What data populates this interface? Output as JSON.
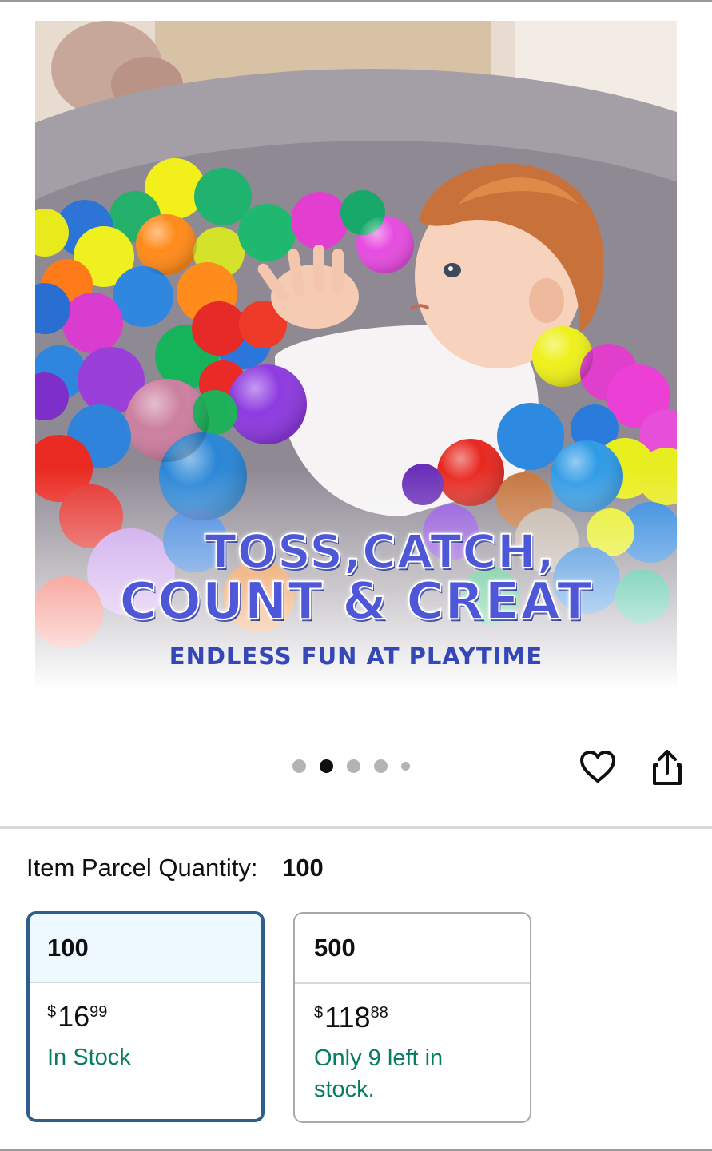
{
  "product_image": {
    "caption_line1": "TOSS,CATCH,",
    "caption_line2": "COUNT & CREAT",
    "caption_line3": "ENDLESS FUN AT PLAYTIME"
  },
  "carousel": {
    "total_dots": 5,
    "active_index": 1
  },
  "actions": {
    "wishlist_icon": "heart-icon",
    "share_icon": "share-icon"
  },
  "quantity": {
    "label": "Item Parcel Quantity:",
    "value": "100"
  },
  "options": [
    {
      "title": "100",
      "price_symbol": "$",
      "price_whole": "16",
      "price_fraction": "99",
      "stock": "In Stock",
      "selected": true
    },
    {
      "title": "500",
      "price_symbol": "$",
      "price_whole": "118",
      "price_fraction": "88",
      "stock": "Only 9 left in stock.",
      "selected": false
    }
  ],
  "colors": {
    "accent_border": "#2e5e8b",
    "stock_green": "#067d62",
    "selected_header_bg": "#edf8ff"
  }
}
